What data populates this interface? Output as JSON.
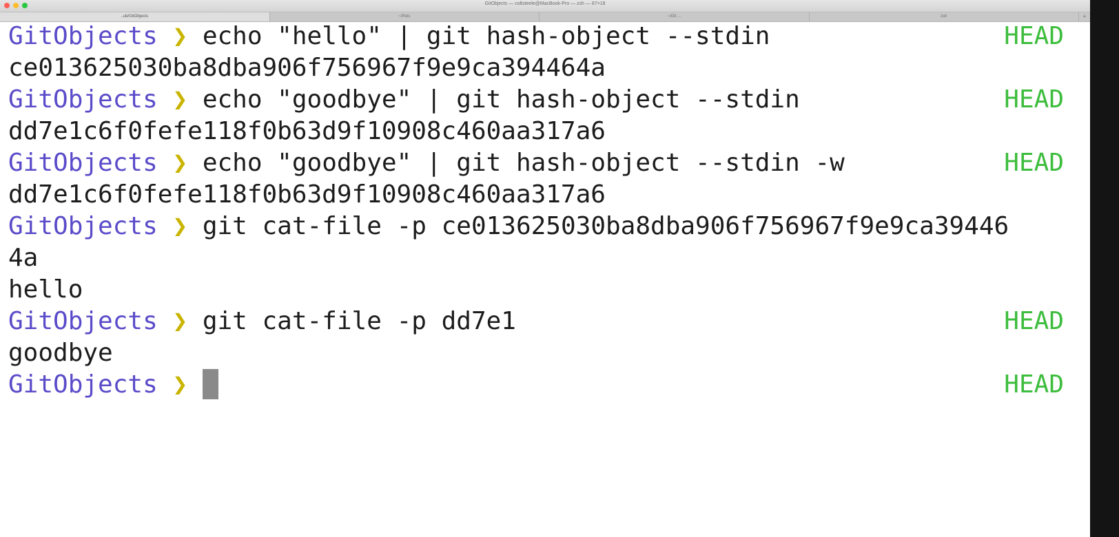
{
  "window": {
    "title": "GitObjects — coltsteele@MacBook-Pro — zsh — 87×18",
    "traffic_colors": {
      "close": "#ff5f57",
      "minimize": "#febc2e",
      "zoom": "#28c840"
    },
    "tabs": [
      {
        "label": "..ub/GitObjects",
        "active": true
      },
      {
        "label": "~/Pets",
        "active": false
      },
      {
        "label": "~/Git ...",
        "active": false
      },
      {
        "label": "zsh",
        "active": false
      }
    ],
    "new_tab_symbol": "+"
  },
  "terminal": {
    "prompt": {
      "dir": "GitObjects",
      "arrow": "❯",
      "branch": "HEAD"
    },
    "lines": [
      {
        "type": "command",
        "text": "echo \"hello\" | git hash-object --stdin",
        "branch": "HEAD"
      },
      {
        "type": "output",
        "text": "ce013625030ba8dba906f756967f9e9ca394464a"
      },
      {
        "type": "command",
        "text": "echo \"goodbye\" | git hash-object --stdin",
        "branch": "HEAD"
      },
      {
        "type": "output",
        "text": "dd7e1c6f0fefe118f0b63d9f10908c460aa317a6"
      },
      {
        "type": "command",
        "text": "echo \"goodbye\" | git hash-object --stdin -w",
        "branch": "HEAD"
      },
      {
        "type": "output",
        "text": "dd7e1c6f0fefe118f0b63d9f10908c460aa317a6"
      },
      {
        "type": "command",
        "text": "git cat-file -p ce013625030ba8dba906f756967f9e9ca39446",
        "branch": ""
      },
      {
        "type": "output",
        "text": "4a"
      },
      {
        "type": "output",
        "text": "hello"
      },
      {
        "type": "command",
        "text": "git cat-file -p dd7e1",
        "branch": "HEAD"
      },
      {
        "type": "output",
        "text": "goodbye"
      },
      {
        "type": "active-prompt",
        "text": "",
        "branch": "HEAD"
      }
    ]
  }
}
